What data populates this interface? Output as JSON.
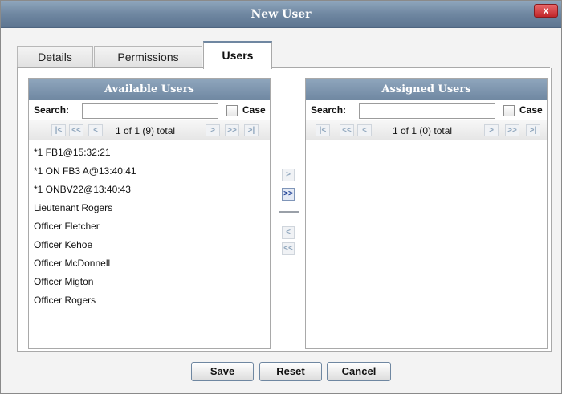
{
  "dialog": {
    "title": "New User",
    "close_label": "x"
  },
  "tabs": [
    {
      "label": "Details",
      "active": false
    },
    {
      "label": "Permissions",
      "active": false
    },
    {
      "label": "Users",
      "active": true
    }
  ],
  "available": {
    "header": "Available Users",
    "search_label": "Search:",
    "search_value": "",
    "case_label": "Case",
    "case_checked": false,
    "pager": {
      "first": "|<",
      "prev_page": "<<",
      "prev": "<",
      "text": "1 of 1 (9) total",
      "next": ">",
      "next_page": ">>",
      "last": ">|"
    },
    "items": [
      "*1 FB1@15:32:21",
      "*1 ON FB3 A@13:40:41",
      "*1 ONBV22@13:40:43",
      "Lieutenant Rogers",
      "Officer Fletcher",
      "Officer Kehoe",
      "Officer McDonnell",
      "Officer Migton",
      "Officer Rogers"
    ]
  },
  "assigned": {
    "header": "Assigned Users",
    "search_label": "Search:",
    "search_value": "",
    "case_label": "Case",
    "case_checked": false,
    "pager": {
      "first": "|<",
      "prev_page": "<<",
      "prev": "<",
      "text": "1 of 1 (0) total",
      "next": ">",
      "next_page": ">>",
      "last": ">|"
    },
    "items": []
  },
  "transfer": {
    "add_one": ">",
    "add_all": ">>",
    "remove_one": "<",
    "remove_all": "<<"
  },
  "footer": {
    "save": "Save",
    "reset": "Reset",
    "cancel": "Cancel"
  },
  "colors": {
    "header_bg": "#6f87a1",
    "close_bg": "#c0262a",
    "strong_arrow": "#1c3f95"
  }
}
